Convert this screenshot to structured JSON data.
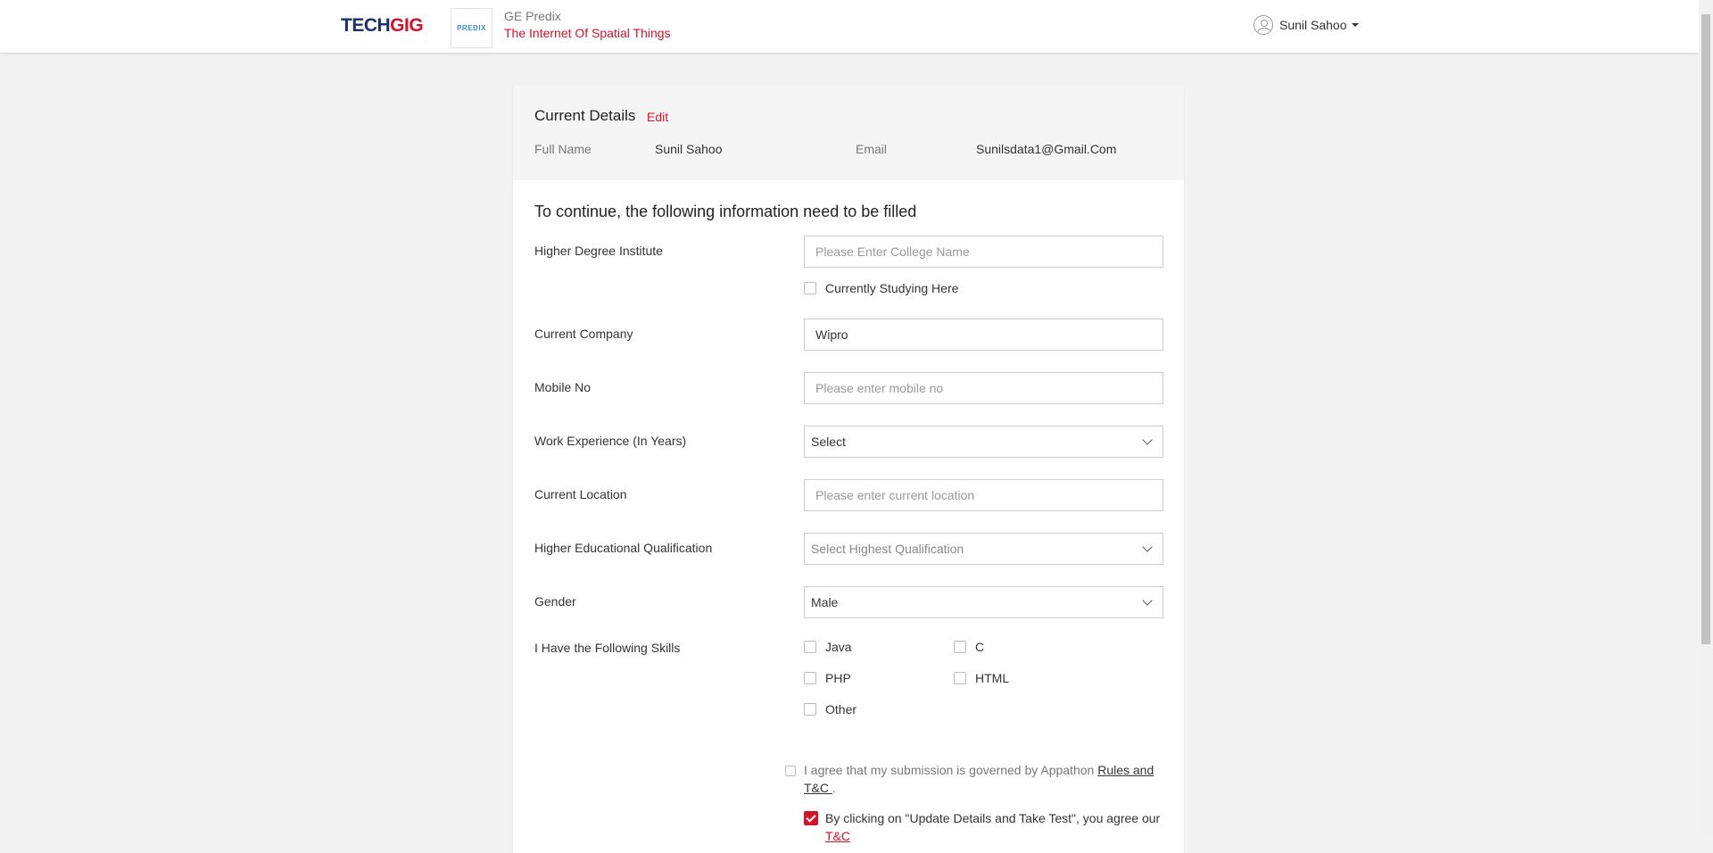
{
  "header": {
    "logo": {
      "part1": "TECH",
      "part2": "GIG"
    },
    "event_logo_text": "PREDIX",
    "event_org": "GE Predix",
    "event_name": "The Internet Of Spatial Things",
    "user_name": "Sunil Sahoo"
  },
  "current_details": {
    "title": "Current Details",
    "edit_label": "Edit",
    "full_name_label": "Full Name",
    "full_name_value": "Sunil Sahoo",
    "email_label": "Email",
    "email_value": "Sunilsdata1@Gmail.Com"
  },
  "form": {
    "title": "To continue, the following information need to be filled",
    "institute": {
      "label": "Higher Degree Institute",
      "value": "",
      "placeholder": "Please Enter College Name"
    },
    "currently_studying": {
      "label": "Currently Studying Here",
      "checked": false
    },
    "company": {
      "label": "Current Company",
      "value": "Wipro",
      "placeholder": ""
    },
    "mobile": {
      "label": "Mobile No",
      "value": "",
      "placeholder": "Please enter mobile no"
    },
    "experience": {
      "label": "Work Experience (In Years)",
      "selected": "Select"
    },
    "location": {
      "label": "Current Location",
      "value": "",
      "placeholder": "Please enter current location"
    },
    "qualification": {
      "label": "Higher Educational Qualification",
      "selected": "Select Highest Qualification"
    },
    "gender": {
      "label": "Gender",
      "selected": "Male"
    },
    "skills": {
      "label": "I Have the Following Skills",
      "options": [
        {
          "name": "Java",
          "checked": false
        },
        {
          "name": "C",
          "checked": false
        },
        {
          "name": "PHP",
          "checked": false
        },
        {
          "name": "HTML",
          "checked": false
        },
        {
          "name": "Other",
          "checked": false
        }
      ]
    },
    "agree_rules": {
      "checked": false,
      "text": "I agree that my submission is governed by Appathon ",
      "link1": "Rules and",
      "link2": "T&C ",
      "suffix": "."
    },
    "agree_tc": {
      "checked": true,
      "text": "By clicking on \"Update Details and Take Test\", you agree our",
      "link": "T&C"
    }
  }
}
